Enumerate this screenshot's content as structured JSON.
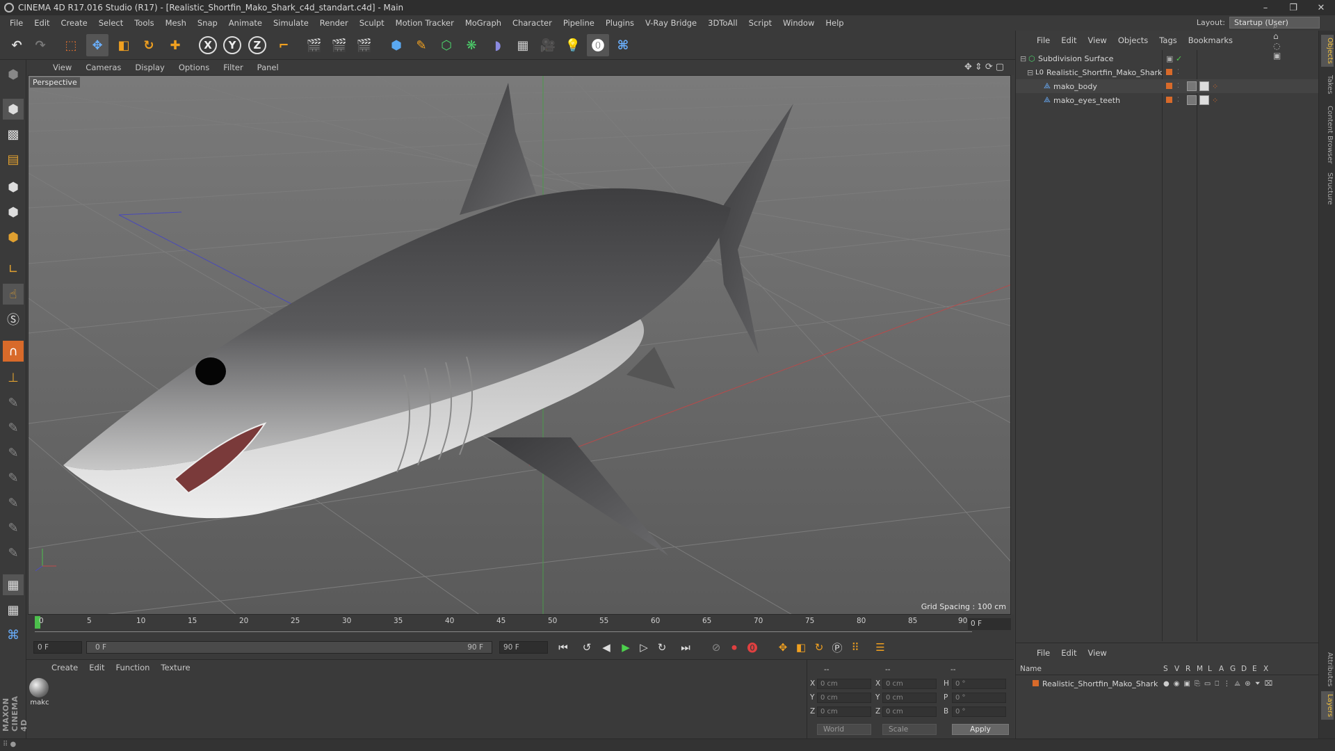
{
  "window": {
    "title": "CINEMA 4D R17.016 Studio (R17) - [Realistic_Shortfin_Mako_Shark_c4d_standart.c4d] - Main",
    "minimize": "–",
    "restore": "❐",
    "close": "✕"
  },
  "menu": [
    "File",
    "Edit",
    "Create",
    "Select",
    "Tools",
    "Mesh",
    "Snap",
    "Animate",
    "Simulate",
    "Render",
    "Sculpt",
    "Motion Tracker",
    "MoGraph",
    "Character",
    "Pipeline",
    "Plugins",
    "V-Ray Bridge",
    "3DToAll",
    "Script",
    "Window",
    "Help"
  ],
  "layout": {
    "label": "Layout:",
    "value": "Startup (User)"
  },
  "toolbar": {
    "x_label": "X",
    "y_label": "Y",
    "z_label": "Z"
  },
  "viewport": {
    "menu": [
      "View",
      "Cameras",
      "Display",
      "Options",
      "Filter",
      "Panel"
    ],
    "label": "Perspective",
    "grid_spacing": "Grid Spacing : 100 cm"
  },
  "timeline": {
    "ticks": [
      "0",
      "5",
      "10",
      "15",
      "20",
      "25",
      "30",
      "35",
      "40",
      "45",
      "50",
      "55",
      "60",
      "65",
      "70",
      "75",
      "80",
      "85",
      "90"
    ],
    "current_frame": "0 F"
  },
  "transport": {
    "start_field": "0 F",
    "range_start": "0 F",
    "range_end": "90 F",
    "end_field": "90 F"
  },
  "material_panel": {
    "menu": [
      "Create",
      "Edit",
      "Function",
      "Texture"
    ],
    "material_name": "makc"
  },
  "coordinates": {
    "header_a": "--",
    "header_b": "--",
    "header_c": "--",
    "rows": [
      {
        "a": "X",
        "av": "0 cm",
        "b": "X",
        "bv": "0 cm",
        "c": "H",
        "cv": "0 °"
      },
      {
        "a": "Y",
        "av": "0 cm",
        "b": "Y",
        "bv": "0 cm",
        "c": "P",
        "cv": "0 °"
      },
      {
        "a": "Z",
        "av": "0 cm",
        "b": "Z",
        "bv": "0 cm",
        "c": "B",
        "cv": "0 °"
      }
    ],
    "mode_world": "World",
    "mode_scale": "Scale",
    "apply": "Apply"
  },
  "objects": {
    "menu": [
      "File",
      "Edit",
      "View",
      "Objects",
      "Tags",
      "Bookmarks"
    ],
    "items": [
      {
        "name": "Subdivision Surface",
        "indent": 0
      },
      {
        "name": "Realistic_Shortfin_Mako_Shark",
        "indent": 1
      },
      {
        "name": "mako_body",
        "indent": 2
      },
      {
        "name": "mako_eyes_teeth",
        "indent": 2
      }
    ]
  },
  "layers": {
    "menu": [
      "File",
      "Edit",
      "View"
    ],
    "col_name": "Name",
    "cols": [
      "S",
      "V",
      "R",
      "M",
      "L",
      "A",
      "G",
      "D",
      "E",
      "X"
    ],
    "row": "Realistic_Shortfin_Mako_Shark"
  },
  "side_tabs": [
    "Objects",
    "Takes",
    "Content Browser",
    "Structure",
    "Attributes",
    "Layers"
  ],
  "branding": "MAXON CINEMA 4D",
  "colors": {
    "accent_orange": "#d86a2a",
    "viewport_bg": "#646464",
    "panel_bg": "#3c3c3c"
  }
}
